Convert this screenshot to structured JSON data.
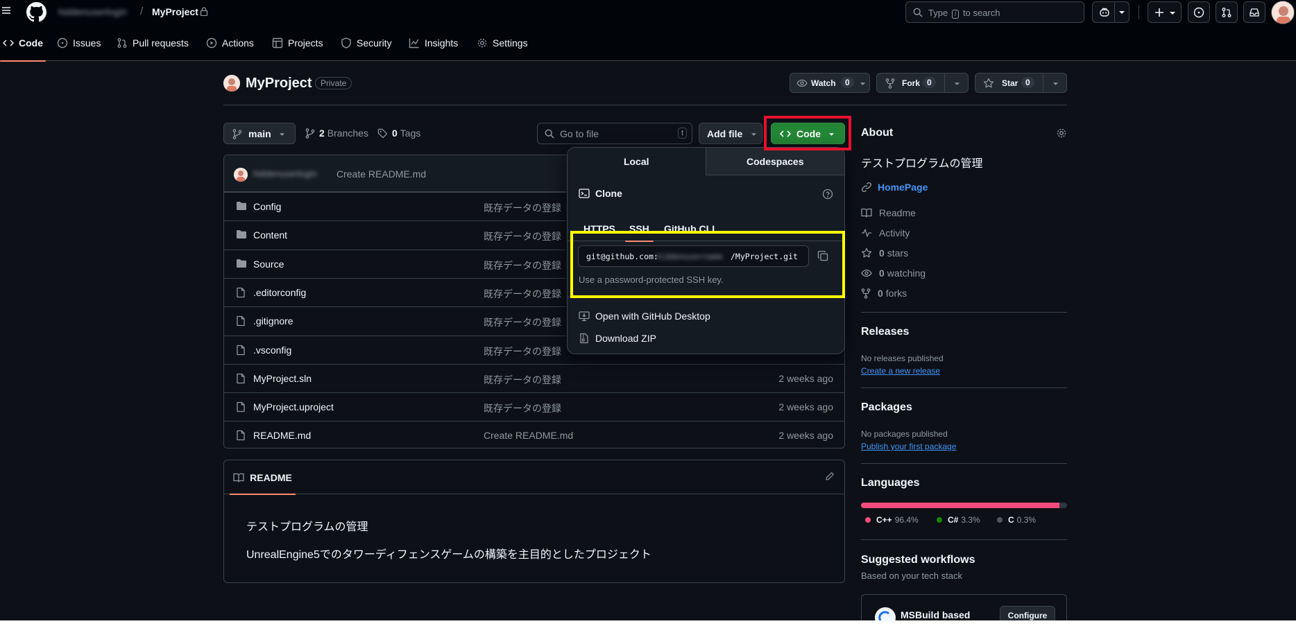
{
  "topbar": {
    "owner": "hiddenuserlogin",
    "separator": "/",
    "repo": "MyProject",
    "search_text_before": "Type",
    "search_key": "/",
    "search_text_after": "to search"
  },
  "nav": [
    {
      "label": "Code",
      "icon": "code-icon"
    },
    {
      "label": "Issues",
      "icon": "issue-icon"
    },
    {
      "label": "Pull requests",
      "icon": "pull-request-icon"
    },
    {
      "label": "Actions",
      "icon": "play-icon"
    },
    {
      "label": "Projects",
      "icon": "table-icon"
    },
    {
      "label": "Security",
      "icon": "shield-icon"
    },
    {
      "label": "Insights",
      "icon": "graph-icon"
    },
    {
      "label": "Settings",
      "icon": "gear-icon"
    }
  ],
  "repo": {
    "title": "MyProject",
    "visibility": "Private",
    "watch_label": "Watch",
    "watch_count": "0",
    "fork_label": "Fork",
    "fork_count": "0",
    "star_label": "Star",
    "star_count": "0"
  },
  "filenav": {
    "branch": "main",
    "branches_count": "2",
    "branches_label": "Branches",
    "tags_count": "0",
    "tags_label": "Tags",
    "goto_placeholder": "Go to file",
    "goto_key": "t",
    "add_file": "Add file",
    "code_button": "Code"
  },
  "commit": {
    "user": "hiddenuserlogin",
    "message": "Create README.md"
  },
  "files": [
    {
      "name": "Config",
      "type": "dir",
      "message": "既存データの登録",
      "date": ""
    },
    {
      "name": "Content",
      "type": "dir",
      "message": "既存データの登録",
      "date": ""
    },
    {
      "name": "Source",
      "type": "dir",
      "message": "既存データの登録",
      "date": ""
    },
    {
      "name": ".editorconfig",
      "type": "file",
      "message": "既存データの登録",
      "date": ""
    },
    {
      "name": ".gitignore",
      "type": "file",
      "message": "既存データの登録",
      "date": ""
    },
    {
      "name": ".vsconfig",
      "type": "file",
      "message": "既存データの登録",
      "date": ""
    },
    {
      "name": "MyProject.sln",
      "type": "file",
      "message": "既存データの登録",
      "date": "2 weeks ago"
    },
    {
      "name": "MyProject.uproject",
      "type": "file",
      "message": "既存データの登録",
      "date": "2 weeks ago"
    },
    {
      "name": "README.md",
      "type": "file",
      "message": "Create README.md",
      "date": "2 weeks ago"
    }
  ],
  "readme": {
    "tab": "README",
    "heading": "テストプログラムの管理",
    "paragraph": "UnrealEngine5でのタワーディフェンスゲームの構築を主目的としたプロジェクト"
  },
  "clone_dropdown": {
    "tab_local": "Local",
    "tab_codespaces": "Codespaces",
    "clone_title": "Clone",
    "protocols": [
      "HTTPS",
      "SSH",
      "GitHub CLI"
    ],
    "active_protocol": "SSH",
    "url_prefix": "git@github.com:",
    "url_owner": "hiddenusername",
    "url_suffix": "/MyProject.git",
    "note": "Use a password-protected SSH key.",
    "open_desktop": "Open with GitHub Desktop",
    "download_zip": "Download ZIP"
  },
  "about": {
    "title": "About",
    "description": "テストプログラムの管理",
    "homepage": "HomePage",
    "readme": "Readme",
    "activity": "Activity",
    "stars_count": "0",
    "stars_label": "stars",
    "watching_count": "0",
    "watching_label": "watching",
    "forks_count": "0",
    "forks_label": "forks"
  },
  "releases": {
    "title": "Releases",
    "none": "No releases published",
    "link": "Create a new release"
  },
  "packages": {
    "title": "Packages",
    "none": "No packages published",
    "link": "Publish your first package"
  },
  "languages": {
    "title": "Languages",
    "items": [
      {
        "name": "C++",
        "percent": "96.4%",
        "value": 96.4,
        "color": "#f34b7d"
      },
      {
        "name": "C#",
        "percent": "3.3%",
        "value": 3.3,
        "color": "#178600"
      },
      {
        "name": "C",
        "percent": "0.3%",
        "value": 0.3,
        "color": "#555555"
      }
    ]
  },
  "workflows": {
    "title": "Suggested workflows",
    "subtitle": "Based on your tech stack",
    "item_name": "MSBuild based",
    "configure": "Configure"
  },
  "highlight_colors": {
    "code_button_box": "#e8102e",
    "ssh_url_box": "#ffff00"
  },
  "accent": "#238636"
}
